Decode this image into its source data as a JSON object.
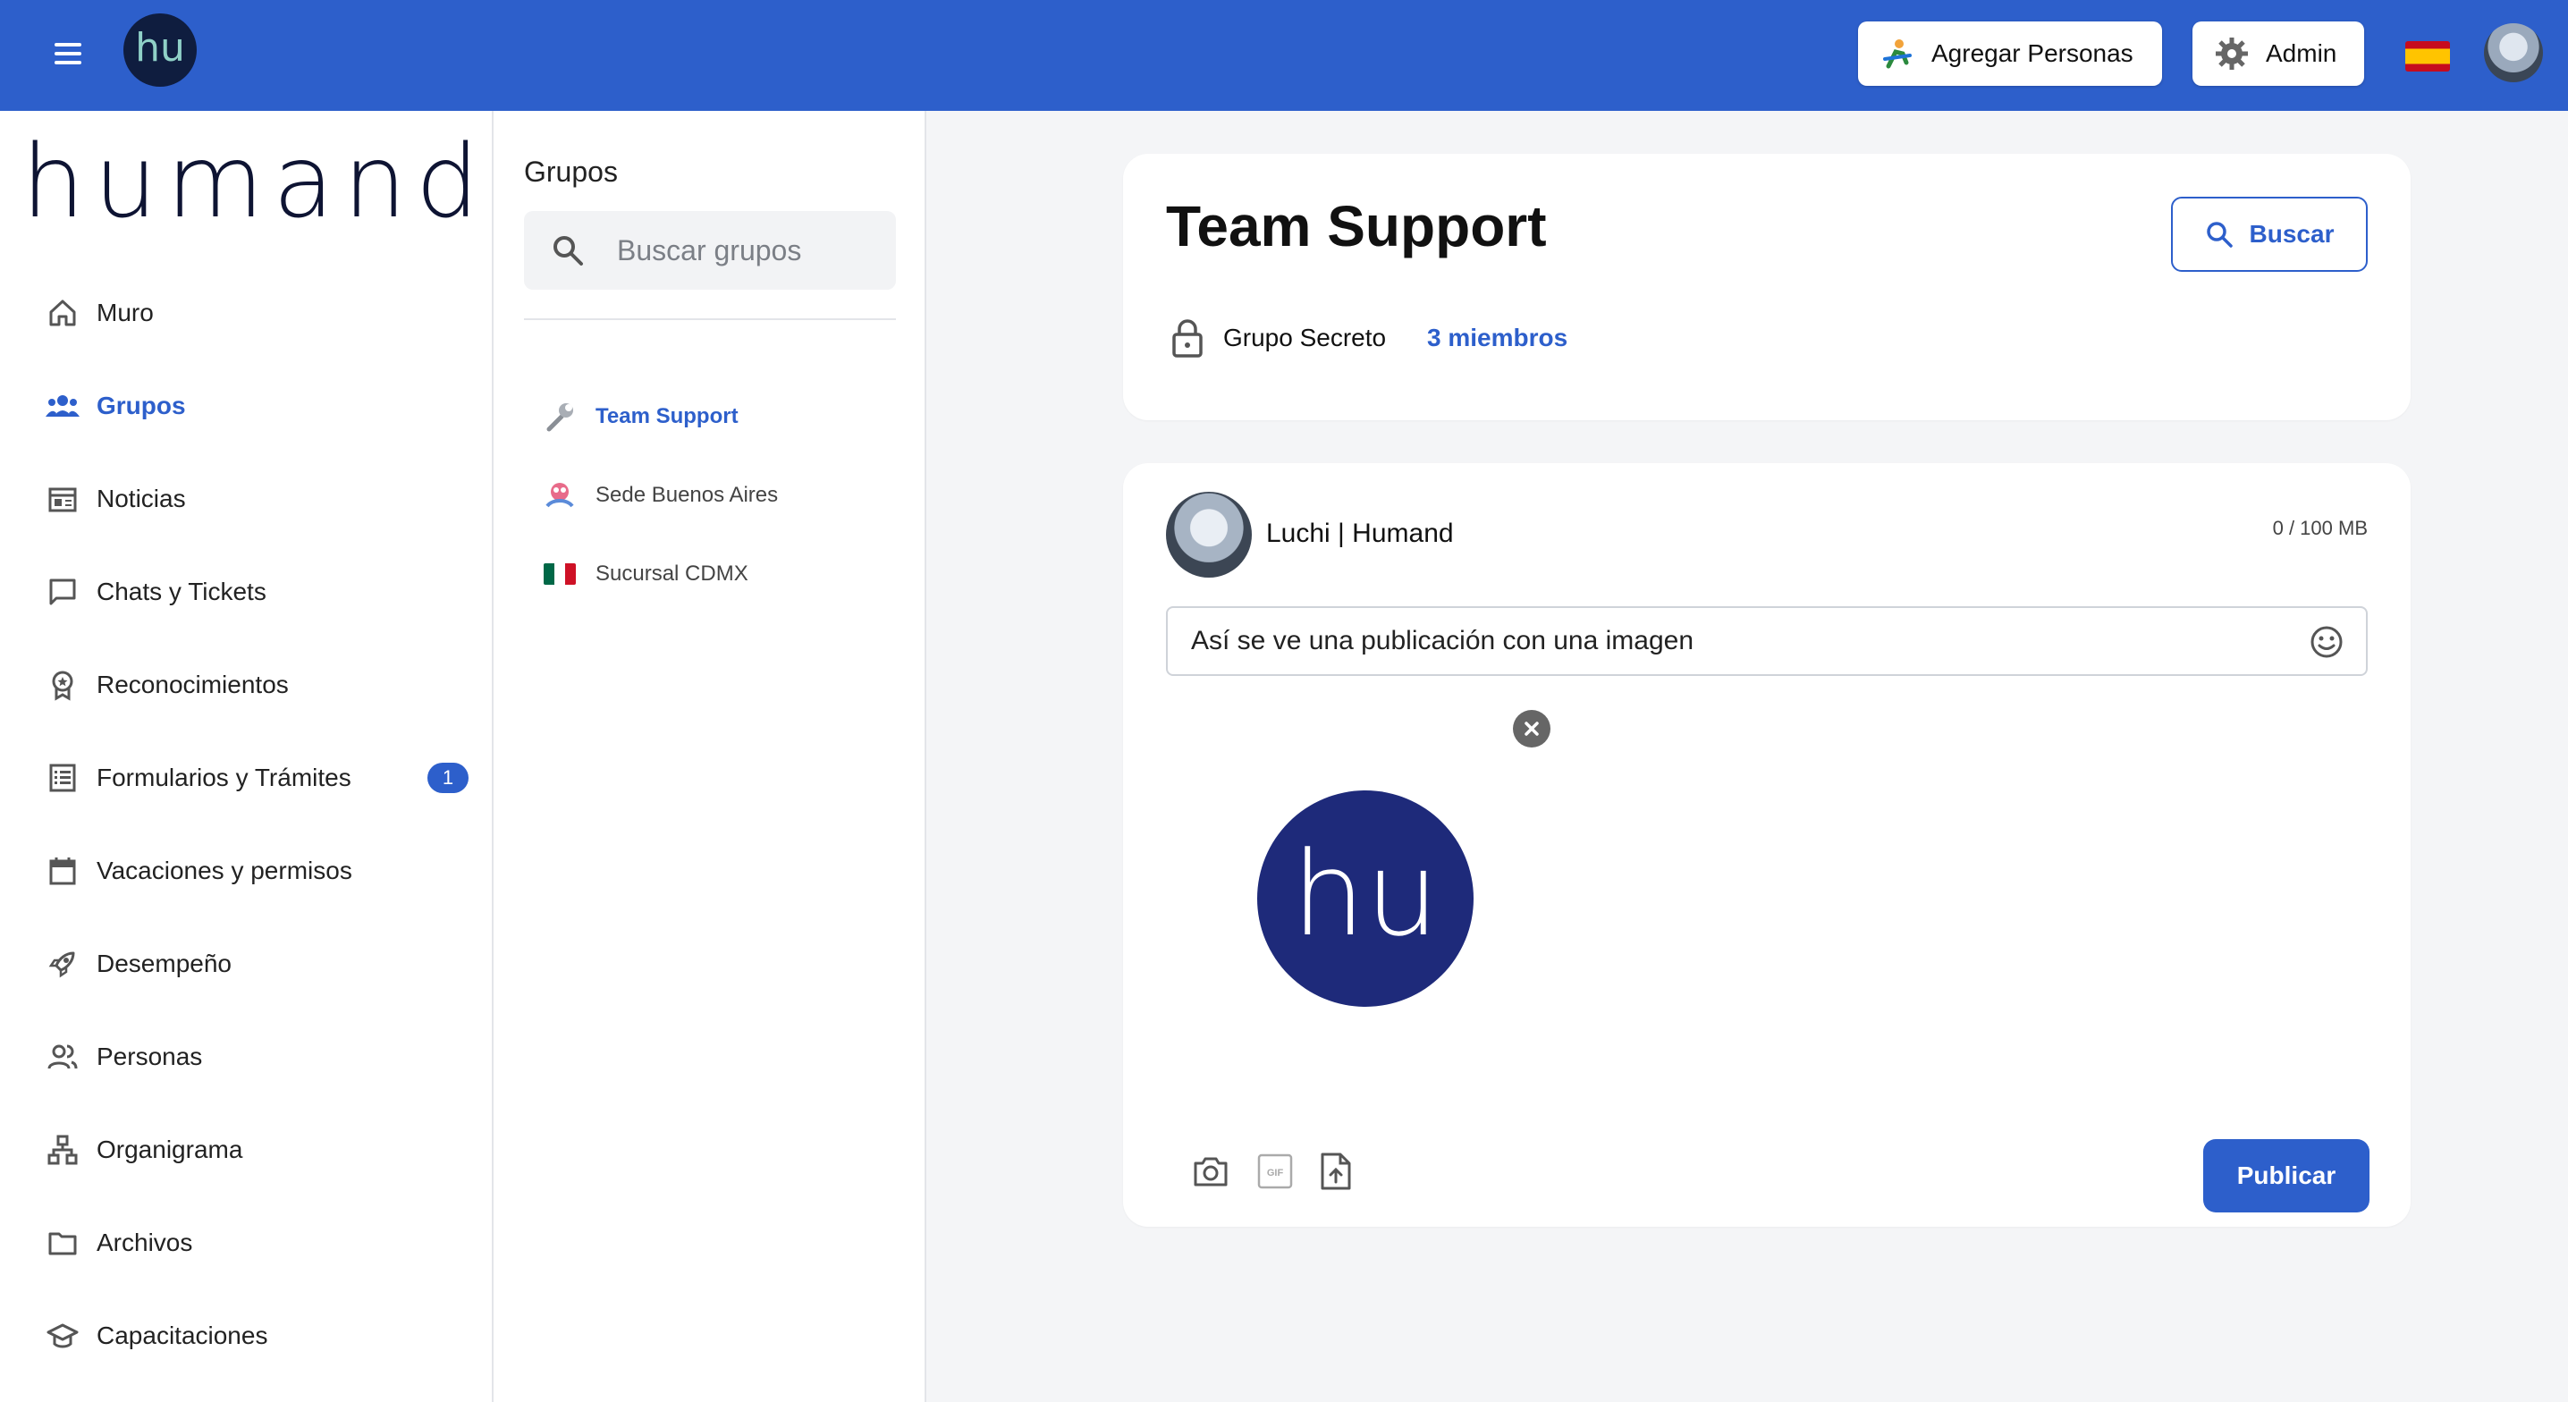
{
  "topbar": {
    "logo_text": "hu",
    "add_people_label": "Agregar Personas",
    "admin_label": "Admin",
    "language": "es"
  },
  "sidebar": {
    "brand": "humand",
    "items": [
      {
        "label": "Muro",
        "icon": "home-icon"
      },
      {
        "label": "Grupos",
        "icon": "groups-icon",
        "active": true
      },
      {
        "label": "Noticias",
        "icon": "news-icon"
      },
      {
        "label": "Chats y Tickets",
        "icon": "chat-icon"
      },
      {
        "label": "Reconocimientos",
        "icon": "award-icon"
      },
      {
        "label": "Formularios y Trámites",
        "icon": "form-icon",
        "badge": "1"
      },
      {
        "label": "Vacaciones y permisos",
        "icon": "calendar-icon"
      },
      {
        "label": "Desempeño",
        "icon": "rocket-icon"
      },
      {
        "label": "Personas",
        "icon": "people-icon"
      },
      {
        "label": "Organigrama",
        "icon": "org-chart-icon"
      },
      {
        "label": "Archivos",
        "icon": "folder-icon"
      },
      {
        "label": "Capacitaciones",
        "icon": "graduation-cap-icon"
      }
    ]
  },
  "groups_panel": {
    "title": "Grupos",
    "search_placeholder": "Buscar grupos",
    "groups": [
      {
        "label": "Team Support",
        "icon": "wrench-icon",
        "active": true
      },
      {
        "label": "Sede Buenos Aires",
        "icon": "building-icon"
      },
      {
        "label": "Sucursal CDMX",
        "icon": "mexico-flag-icon"
      }
    ]
  },
  "group_header": {
    "title": "Team Support",
    "search_label": "Buscar",
    "privacy": "Grupo Secreto",
    "members": "3 miembros"
  },
  "composer": {
    "author": "Luchi | Humand",
    "storage": "0 / 100 MB",
    "text": "Así se ve una publicación con una imagen",
    "preview_text": "hu",
    "publish_label": "Publicar",
    "gif_label": "GIF"
  },
  "colors": {
    "primary": "#2d5fcb",
    "brand_dark": "#0e1433",
    "preview_bg": "#1e2a7a"
  }
}
